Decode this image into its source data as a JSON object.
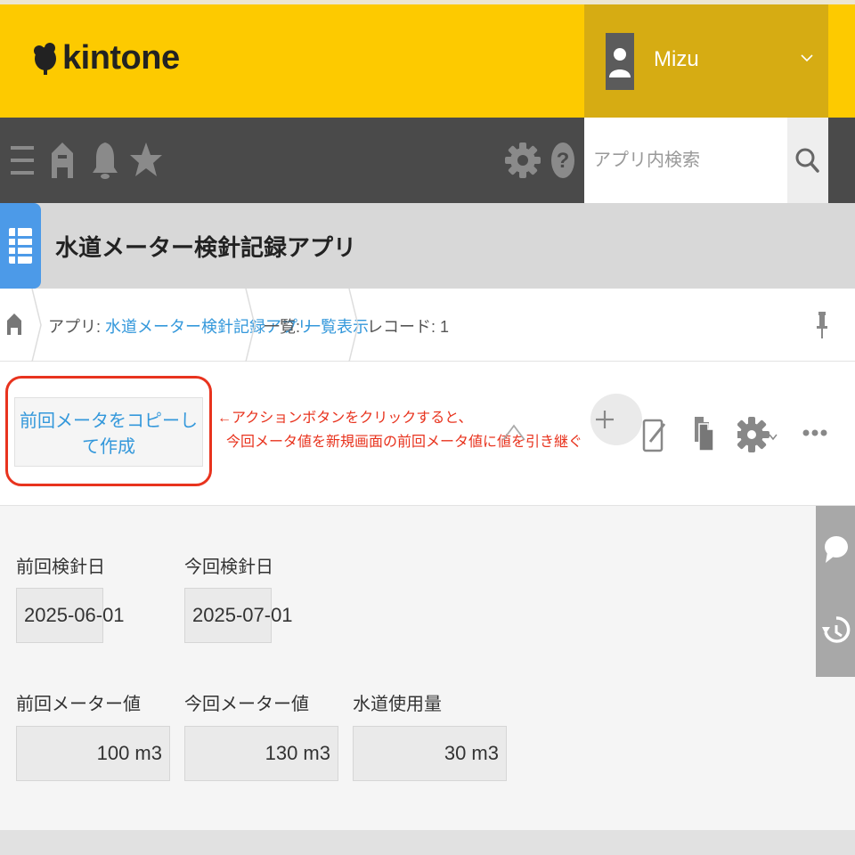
{
  "header": {
    "logo_text": "kintone",
    "user_name": "Mizu"
  },
  "nav": {
    "icons": [
      "menu-icon",
      "home-icon",
      "bell-icon",
      "star-icon",
      "gear-icon",
      "help-icon"
    ],
    "search_placeholder": "アプリ内検索"
  },
  "app": {
    "title": "水道メーター検針記録アプリ"
  },
  "breadcrumb": {
    "app_prefix": "アプリ: ",
    "app_link": "水道メーター検針記録アプリ",
    "list_prefix": "一覧: ",
    "list_link": "一覧表示",
    "record_text": "レコード: 1"
  },
  "toolbar": {
    "action_button_label": "前回メータをコピーして作成",
    "annotation_line1": "←アクションボタンをクリックすると、",
    "annotation_line2": "今回メータ値を新規画面の前回メータ値に値を引き継ぐ",
    "icons": [
      "chevron-up-icon",
      "add-icon",
      "edit-icon",
      "duplicate-icon",
      "gear-icon",
      "more-icon"
    ]
  },
  "record": {
    "fields": [
      {
        "label": "前回検針日",
        "value": "2025-06-01"
      },
      {
        "label": "今回検針日",
        "value": "2025-07-01"
      },
      {
        "label": "前回メーター値",
        "value": "100 m3"
      },
      {
        "label": "今回メーター値",
        "value": "130 m3"
      },
      {
        "label": "水道使用量",
        "value": "30 m3"
      }
    ]
  },
  "side_panel": {
    "icons": [
      "comment-icon",
      "history-icon"
    ]
  },
  "colors": {
    "header_bg": "#fdca00",
    "user_bg": "#d6ac13",
    "nav_bg": "#4a4a4a",
    "link": "#3498db",
    "annotation": "#e8331e",
    "app_icon": "#4c9ae8"
  }
}
